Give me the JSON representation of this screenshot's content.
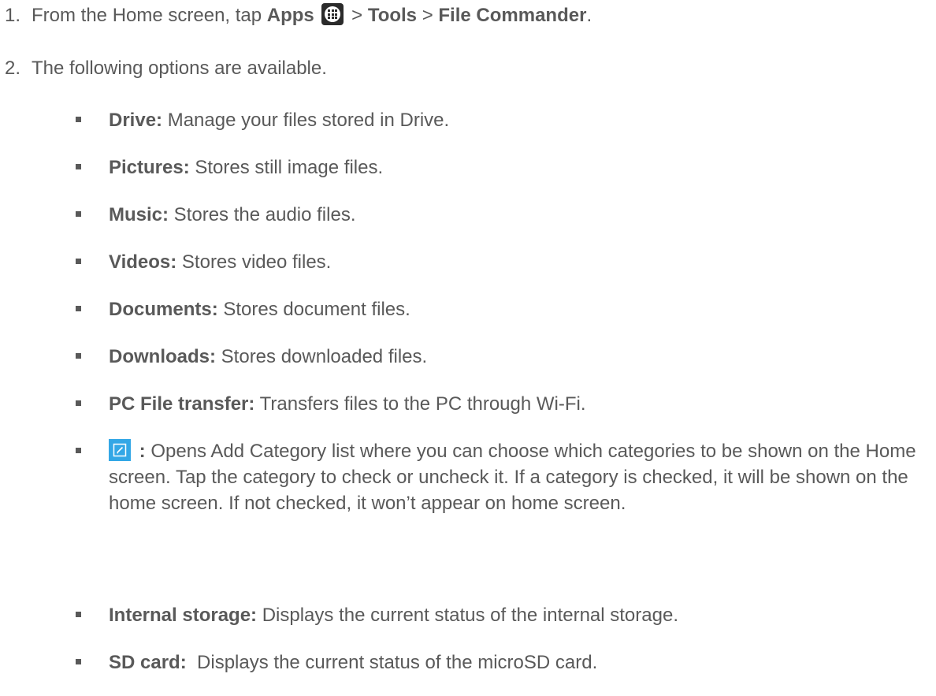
{
  "steps": [
    {
      "number": "1.",
      "text_before": "From the Home screen, tap ",
      "apps_label": "Apps",
      "sep1": " > ",
      "tools_label": "Tools",
      "sep2": " > ",
      "file_commander_label": "File Commander",
      "text_after": "."
    },
    {
      "number": "2.",
      "text": "The following options are available."
    }
  ],
  "options": [
    {
      "term": "Drive:",
      "desc": " Manage your files stored in Drive."
    },
    {
      "term": "Pictures:",
      "desc": " Stores still image files."
    },
    {
      "term": "Music:",
      "desc": " Stores the audio files."
    },
    {
      "term": "Videos:",
      "desc": " Stores video files."
    },
    {
      "term": "Documents:",
      "desc": " Stores document files."
    },
    {
      "term": "Downloads:",
      "desc": " Stores downloaded files."
    },
    {
      "term": "PC File transfer:",
      "desc": " Transfers files to the PC through Wi-Fi."
    },
    {
      "term": " :",
      "desc": " Opens Add Category list where you can choose which categories to be shown on the Home screen. Tap the category to check or uncheck it. If a category is checked, it will be shown on the home screen. If not checked, it won’t appear on home screen.",
      "icon": "edit-icon"
    },
    {
      "term": "Internal storage:",
      "desc": " Displays the current status of the internal storage."
    },
    {
      "term": "SD card:",
      "desc": "  Displays the current status of the microSD card."
    }
  ],
  "icons": {
    "apps": "apps-grid-icon",
    "edit": "edit-pencil-icon"
  },
  "colors": {
    "text": "#595959",
    "edit_icon_bg": "#33a7e6",
    "apps_icon_bg": "#2b2b2b"
  }
}
